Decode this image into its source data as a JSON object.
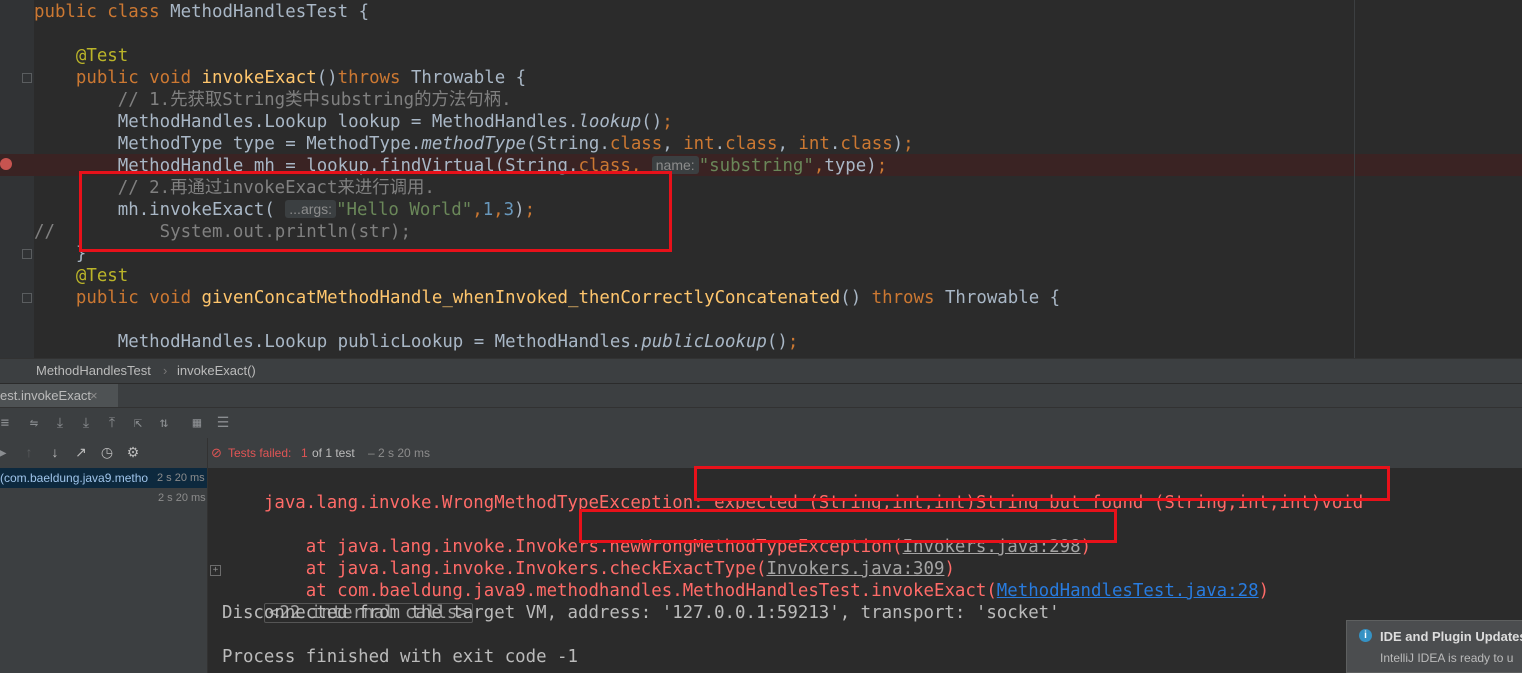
{
  "editor": {
    "lines": [
      {
        "parts": [
          [
            "kw",
            "public class "
          ],
          [
            "plain",
            "MethodHandlesTest {"
          ]
        ]
      },
      {
        "parts": []
      },
      {
        "parts": [
          [
            "ann",
            "    @Test"
          ]
        ]
      },
      {
        "parts": [
          [
            "kw",
            "    public void "
          ],
          [
            "fn",
            "invokeExact"
          ],
          [
            "plain",
            "()"
          ],
          [
            "kw",
            "throws "
          ],
          [
            "plain",
            "Throwable {"
          ]
        ]
      },
      {
        "parts": [
          [
            "cmt",
            "        // 1.先获取String类中substring的方法句柄."
          ]
        ]
      },
      {
        "parts": [
          [
            "plain",
            "        MethodHandles.Lookup lookup = MethodHandles."
          ],
          [
            "it",
            "lookup"
          ],
          [
            "plain",
            "()"
          ],
          [
            "kw",
            ";"
          ]
        ]
      },
      {
        "parts": [
          [
            "plain",
            "        MethodType type = MethodType."
          ],
          [
            "it",
            "methodType"
          ],
          [
            "plain",
            "(String."
          ],
          [
            "kw",
            "class"
          ],
          [
            "plain",
            ", "
          ],
          [
            "kw",
            "int"
          ],
          [
            "plain",
            "."
          ],
          [
            "kw",
            "class"
          ],
          [
            "plain",
            ", "
          ],
          [
            "kw",
            "int"
          ],
          [
            "plain",
            "."
          ],
          [
            "kw",
            "class"
          ],
          [
            "plain",
            ")"
          ],
          [
            "kw",
            ";"
          ]
        ]
      },
      {
        "parts": [
          [
            "plain",
            "        MethodHandle mh = lookup.findVirtual(String."
          ],
          [
            "kw",
            "class"
          ],
          [
            "kw",
            ", "
          ],
          [
            "hint",
            "name:"
          ],
          [
            "str",
            "\"substring\""
          ],
          [
            "kw",
            ","
          ],
          [
            "plain",
            "type)"
          ],
          [
            "kw",
            ";"
          ]
        ]
      },
      {
        "parts": [
          [
            "cmt",
            "        // 2.再通过invokeExact来进行调用."
          ]
        ]
      },
      {
        "parts": [
          [
            "plain",
            "        mh.invokeExact( "
          ],
          [
            "hint",
            "...args:"
          ],
          [
            "str",
            "\"Hello World\""
          ],
          [
            "kw",
            ","
          ],
          [
            "num",
            "1"
          ],
          [
            "kw",
            ","
          ],
          [
            "num",
            "3"
          ],
          [
            "plain",
            ")"
          ],
          [
            "kw",
            ";"
          ]
        ]
      },
      {
        "parts": [
          [
            "cmt",
            "//          System.out.println(str);"
          ]
        ]
      },
      {
        "parts": [
          [
            "plain",
            "    }"
          ]
        ]
      },
      {
        "parts": [
          [
            "ann",
            "    @Test"
          ]
        ]
      },
      {
        "parts": [
          [
            "kw",
            "    public void "
          ],
          [
            "fn",
            "givenConcatMethodHandle_whenInvoked_thenCorrectlyConcatenated"
          ],
          [
            "plain",
            "() "
          ],
          [
            "kw",
            "throws "
          ],
          [
            "plain",
            "Throwable {"
          ]
        ]
      },
      {
        "parts": []
      },
      {
        "parts": [
          [
            "plain",
            "        MethodHandles.Lookup publicLookup = MethodHandles."
          ],
          [
            "it",
            "publicLookup"
          ],
          [
            "plain",
            "()"
          ],
          [
            "kw",
            ";"
          ]
        ]
      }
    ]
  },
  "breadcrumb": {
    "file": "MethodHandlesTest",
    "method": "invokeExact()"
  },
  "run_tab": {
    "label": "est.invokeExact",
    "close": "×"
  },
  "tree": {
    "row1_label": "(com.baeldung.java9.metho",
    "row1_time": "2 s 20 ms",
    "row2_time": "2 s 20 ms"
  },
  "status": {
    "failed_label": "Tests failed:",
    "failed_count": "1",
    "of_text": "of 1 test",
    "duration": "– 2 s 20 ms"
  },
  "console": {
    "exception_prefix": "java.lang.invoke.WrongMethodTypeException: ",
    "exception_msg": "expected (String,int,int)String but found (String,int,int)void",
    "trace1_prefix": "    at java.lang.invoke.Invokers.",
    "trace1_method": "newWrongMethodTypeException(",
    "trace1_link": "Invokers.java:298",
    "trace1_suffix": ")",
    "trace2_prefix": "    at java.lang.invoke.Invokers.checkExactType(",
    "trace2_link": "Invokers.java:309",
    "trace2_suffix": ")",
    "trace3_prefix": "    at com.baeldung.java9.methodhandles.MethodHandlesTest.invokeExact(",
    "trace3_link": "MethodHandlesTest.java:28",
    "trace3_suffix": ")",
    "internal_calls": "<22 internal calls>",
    "disconnected": "Disconnected from the target VM, address: '127.0.0.1:59213', transport: 'socket'",
    "finished": "Process finished with exit code -1"
  },
  "notification": {
    "title": "IDE and Plugin Updates",
    "body": "IntelliJ IDEA is ready to u"
  },
  "colors": {
    "error": "#ff6b68",
    "highlight_box": "#e8111a",
    "link": "#287bde"
  }
}
